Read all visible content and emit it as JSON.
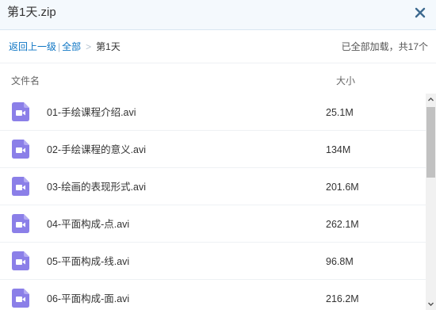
{
  "window": {
    "title": "第1天.zip"
  },
  "toolbar": {
    "back_label": "返回上一级",
    "all_label": "全部",
    "current_label": "第1天",
    "status": "已全部加载，共17个"
  },
  "columns": {
    "name": "文件名",
    "size": "大小"
  },
  "files": [
    {
      "name": "01-手绘课程介绍.avi",
      "size": "25.1M"
    },
    {
      "name": "02-手绘课程的意义.avi",
      "size": "134M"
    },
    {
      "name": "03-绘画的表现形式.avi",
      "size": "201.6M"
    },
    {
      "name": "04-平面构成-点.avi",
      "size": "262.1M"
    },
    {
      "name": "05-平面构成-线.avi",
      "size": "96.8M"
    },
    {
      "name": "06-平面构成-面.avi",
      "size": "216.2M"
    }
  ],
  "colors": {
    "accent": "#0d75c4",
    "video_icon": "#8b7fe8",
    "titlebar_bg": "#f4f9fd"
  },
  "icons": {
    "close": "close-icon",
    "file": "video-file-icon"
  }
}
